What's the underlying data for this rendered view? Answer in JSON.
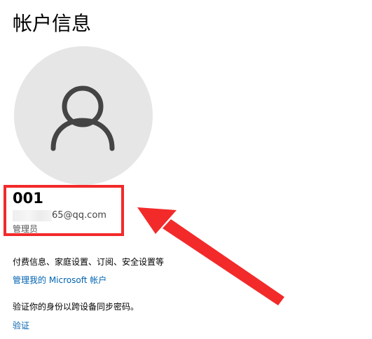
{
  "page": {
    "title": "帐户信息"
  },
  "avatar": {
    "icon": "person-icon"
  },
  "account": {
    "username": "001",
    "email_visible": "65@qq.com",
    "role": "管理员"
  },
  "links": {
    "billing_text": "付费信息、家庭设置、订阅、安全设置等",
    "manage_account": "管理我的 Microsoft 帐户",
    "verify_text": "验证你的身份以跨设备同步密码。",
    "verify": "验证"
  },
  "annotation": {
    "highlight_color": "#f22a2a",
    "arrow_color": "#f22a2a"
  },
  "colors": {
    "link": "#0063b1",
    "avatar_bg": "#e6e6e6",
    "avatar_icon": "#444444"
  }
}
